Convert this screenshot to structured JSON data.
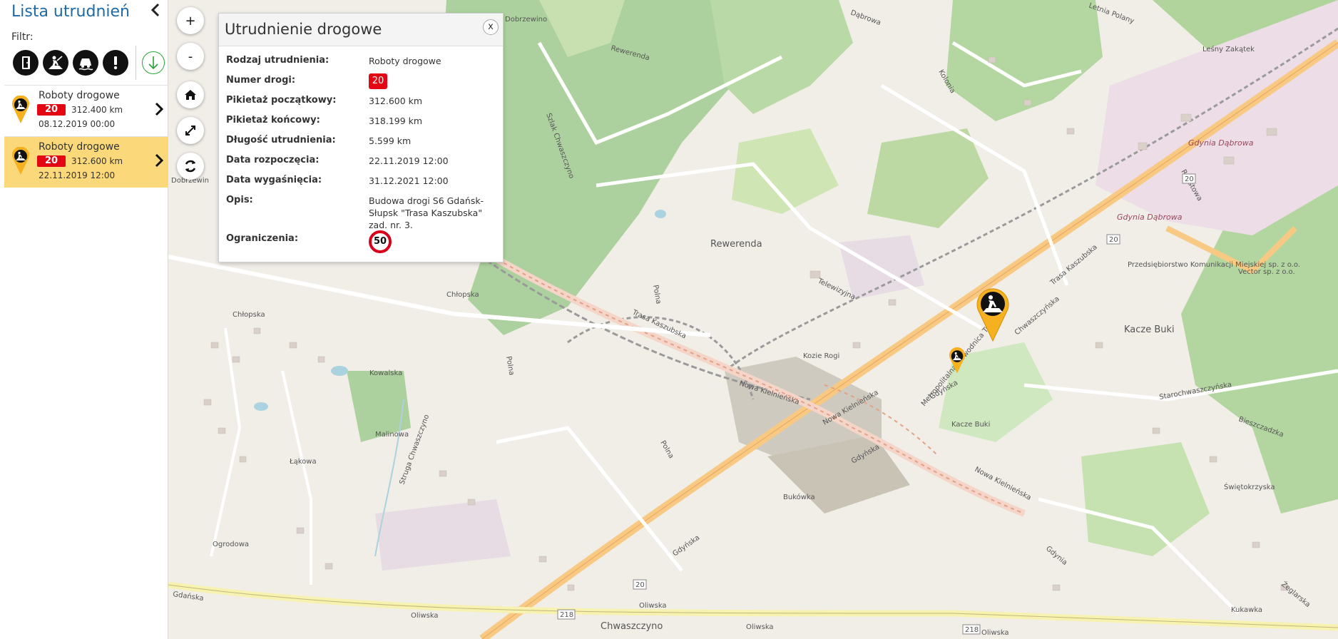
{
  "sidebar": {
    "title": "Lista utrudnień",
    "filter_label": "Filtr:",
    "filters": [
      {
        "icon": "door-icon"
      },
      {
        "icon": "roadworks-icon"
      },
      {
        "icon": "car-accident-icon"
      },
      {
        "icon": "warning-icon"
      }
    ],
    "items": [
      {
        "name": "Roboty drogowe",
        "road": "20",
        "km": "312.400 km",
        "date": "08.12.2019 00:00"
      },
      {
        "name": "Roboty drogowe",
        "road": "20",
        "km": "312.600 km",
        "date": "22.11.2019 12:00"
      }
    ]
  },
  "map_controls": {
    "zoom_in": "+",
    "zoom_out": "-"
  },
  "popup": {
    "title": "Utrudnienie drogowe",
    "close": "x",
    "rows": [
      {
        "label": "Rodzaj utrudnienia:",
        "value": "Roboty drogowe"
      },
      {
        "label": "Numer drogi:",
        "value": "20"
      },
      {
        "label": "Pikietaż początkowy:",
        "value": "312.600 km"
      },
      {
        "label": "Pikietaż końcowy:",
        "value": "318.199 km"
      },
      {
        "label": "Długość utrudnienia:",
        "value": "5.599 km"
      },
      {
        "label": "Data rozpoczęcia:",
        "value": "22.11.2019 12:00"
      },
      {
        "label": "Data wygaśnięcia:",
        "value": "31.12.2021 12:00"
      },
      {
        "label": "Opis:",
        "value": "Budowa drogi S6 Gdańsk-Słupsk \"Trasa Kaszubska\" zad. nr. 3."
      },
      {
        "label": "Ograniczenia:",
        "value": "50"
      }
    ]
  },
  "map_labels": {
    "rewerenda": "Rewerenda",
    "kozie_rogi": "Kozie Rogi",
    "kacze_buki": "Kacze Buki",
    "kacze_buki2": "Kacze Buki",
    "bukowka": "Bukówka",
    "chwaszczyno": "Chwaszczyno",
    "gdynia_dabrowa": "Gdynia Dąbrowa",
    "gdynia_dabrowa2": "Gdynia Dąbrowa",
    "trasa_kaszubska": "Trasa Kaszubska",
    "trasa_kaszubska2": "Trasa Kaszubska",
    "nowa_kielnienska": "Nowa Kielnieńska",
    "nowa_kielnienska2": "Nowa Kielnieńska",
    "nowa_kielnienska3": "Nowa Kielnieńska",
    "gdynska": "Gdyńska",
    "gdynska2": "Gdyńska",
    "gdynska3": "Gdyńska",
    "oliwska": "Oliwska",
    "oliwska2": "Oliwska",
    "oliwska3": "Oliwska",
    "oliwska4": "Oliwska",
    "gdanska": "Gdańska",
    "chlopska": "Chłopska",
    "chlopska2": "Chłopska",
    "chwaszczynska": "Chwaszczyńska",
    "starochwaszczynska": "Starochwaszczyńska",
    "metropolitalna": "Metropolitalna Obwodnica Trójmiasta",
    "road20a": "20",
    "road20b": "20",
    "road20c": "20",
    "road218a": "218",
    "road218b": "218",
    "mzk": "Przedsiębiorstwo Komunikacji Miejskiej sp. z o.o.",
    "vector": "Vector sp. z o.o.",
    "lesny_zakatek": "Leśny Zakątek",
    "dobrzewino": "Dobrzewino",
    "dobrzewin_cut": "Dobrzewin",
    "kolonia": "Kolonia",
    "bieszczadzka": "Bieszczadzka",
    "swietokrzyska": "Świętokrzyska",
    "kukawka": "Kukawka",
    "ogrodowa": "Ogrodowa",
    "telewizyjna": "Telewizyjna",
    "rdestowa": "Rdestowa",
    "lakowa": "Łąkowa",
    "malinowa": "Malinowa",
    "kowalska": "Kowalska",
    "polna": "Polna",
    "polna2": "Polna",
    "polna3": "Polna",
    "szlak": "Szlak Chwaszczyno",
    "strugakwaszczyno": "Struga Chwaszczyno",
    "rewerenda_st": "Rewerenda",
    "dabrowa_river": "Dąbrowa",
    "gdynia_small": "Gdynia",
    "letnia": "Letnia Polany",
    "zeglarska": "Żeglarska"
  }
}
